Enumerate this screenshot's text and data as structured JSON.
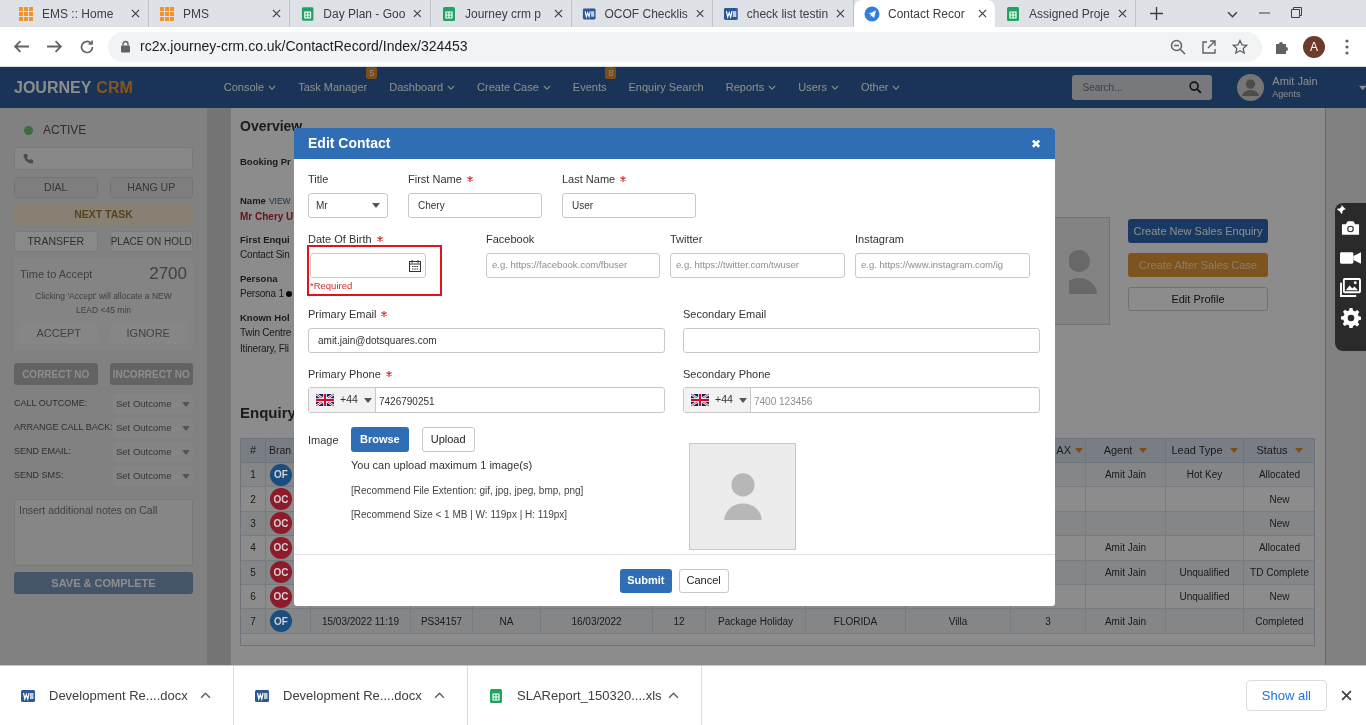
{
  "browser": {
    "tabs": [
      {
        "title": "EMS :: Home",
        "kind": "grid",
        "selected": false
      },
      {
        "title": "PMS",
        "kind": "grid",
        "selected": false
      },
      {
        "title": "Day Plan - Goo",
        "kind": "sheet",
        "selected": false
      },
      {
        "title": "Journey crm p",
        "kind": "sheet",
        "selected": false
      },
      {
        "title": "OCOF Checklis",
        "kind": "word",
        "selected": false
      },
      {
        "title": "check list testin",
        "kind": "word",
        "selected": false
      },
      {
        "title": "Contact Recor",
        "kind": "plane",
        "selected": true
      },
      {
        "title": "Assigned Proje",
        "kind": "sheet",
        "selected": false
      }
    ],
    "url": "rc2x.journey-crm.co.uk/ContactRecord/Index/324453",
    "profile_initial": "A"
  },
  "header": {
    "logo": [
      "JOURNEY",
      "CRM"
    ],
    "nav": [
      {
        "label": "Console",
        "dropdown": true
      },
      {
        "label": "Task Manager",
        "dropdown": false,
        "badge": "5"
      },
      {
        "label": "Dashboard",
        "dropdown": true
      },
      {
        "label": "Create Case",
        "dropdown": true
      },
      {
        "label": "Events",
        "dropdown": false,
        "badge": "8"
      },
      {
        "label": "Enquiry Search",
        "dropdown": false
      },
      {
        "label": "Reports",
        "dropdown": true
      },
      {
        "label": "Users",
        "dropdown": true
      },
      {
        "label": "Other",
        "dropdown": true
      }
    ],
    "search_placeholder": "Search...",
    "user": {
      "name": "Amit Jain",
      "role": "Agents"
    }
  },
  "call_panel": {
    "status": "ACTIVE",
    "dial": "DIAL",
    "hang_up": "HANG UP",
    "next_task": "NEXT TASK",
    "transfer": "TRANSFER",
    "hold": "PLACE ON HOLD",
    "accept_box": {
      "label": "Time to Accept",
      "timer": "2700",
      "message": "Clicking 'Accept' will allocate a NEW LEAD <45 min",
      "accept": "ACCEPT",
      "ignore": "IGNORE"
    },
    "correct": "CORRECT NO",
    "incorrect": "INCORRECT NO",
    "outcomes": [
      {
        "label": "CALL OUTCOME:",
        "value": "Set Outcome"
      },
      {
        "label": "ARRANGE CALL BACK:",
        "value": "Set Outcome"
      },
      {
        "label": "SEND EMAIL:",
        "value": "Set Outcome"
      },
      {
        "label": "SEND SMS:",
        "value": "Set Outcome"
      }
    ],
    "notes_placeholder": "Insert additional notes on Call",
    "save": "SAVE & COMPLETE"
  },
  "overview": {
    "heading": "Overview",
    "booking_label": "Booking Pr",
    "name_label": "Name",
    "view_link": "VIEW",
    "name": "Mr Chery U",
    "fields": [
      {
        "label": "First Enqui",
        "lines": [
          "Contact Sin"
        ]
      },
      {
        "label": "Persona",
        "lines": [
          "Persona 1"
        ]
      },
      {
        "label": "Known Hol",
        "lines": [
          "Twin Centre",
          "Itinerary, Fli"
        ]
      }
    ],
    "actions": [
      {
        "label": "Create New Sales Enquiry",
        "kind": "primary"
      },
      {
        "label": "Create After Sales Case",
        "kind": "warning"
      },
      {
        "label": "Edit Profile",
        "kind": "default"
      }
    ]
  },
  "enquiries": {
    "heading": "Enquiry",
    "columns": [
      {
        "label": "#",
        "sortable": false
      },
      {
        "label": "Bran"
      },
      null,
      null,
      null,
      null,
      null,
      null,
      null,
      null,
      {
        "label": "AX",
        "sortable": true
      },
      {
        "label": "Agent",
        "sortable": true
      },
      {
        "label": "Lead Type",
        "sortable": true
      },
      {
        "label": "Status",
        "sortable": true
      }
    ],
    "rows": [
      {
        "cells": [
          "1",
          {
            "badge": "OF",
            "color": "#1a4d80"
          },
          null,
          null,
          null,
          null,
          null,
          null,
          null,
          null,
          null,
          "Amit Jain",
          "Hot Key",
          "Allocated"
        ]
      },
      {
        "cells": [
          "2",
          {
            "badge": "OC",
            "color": "#8e1b2b"
          },
          null,
          null,
          null,
          null,
          null,
          null,
          null,
          null,
          null,
          null,
          null,
          "New"
        ]
      },
      {
        "cells": [
          "3",
          {
            "badge": "OC",
            "color": "#8e1b2b"
          },
          null,
          null,
          null,
          null,
          null,
          null,
          null,
          null,
          null,
          null,
          null,
          "New"
        ]
      },
      {
        "cells": [
          "4",
          {
            "badge": "OC",
            "color": "#8e1b2b"
          },
          null,
          null,
          null,
          null,
          null,
          null,
          null,
          null,
          null,
          "Amit Jain",
          null,
          "Allocated"
        ]
      },
      {
        "cells": [
          "5",
          {
            "badge": "OC",
            "color": "#8e1b2b"
          },
          null,
          null,
          null,
          null,
          null,
          null,
          null,
          null,
          null,
          "Amit Jain",
          "Unqualified",
          "TD Complete"
        ]
      },
      {
        "cells": [
          "6",
          {
            "badge": "OC",
            "color": "#8e1b2b"
          },
          null,
          null,
          null,
          null,
          null,
          null,
          null,
          null,
          null,
          null,
          "Unqualified",
          "New"
        ]
      },
      {
        "cells": [
          "7",
          {
            "badge": "OF",
            "color": "#1a4d80"
          },
          "15/03/2022 11:19",
          "PS34157",
          "NA",
          "16/03/2022",
          "12",
          "Package Holiday",
          "FLORIDA",
          "Villa",
          "3",
          "Amit Jain",
          null,
          "Completed"
        ]
      }
    ]
  },
  "modal": {
    "title": "Edit Contact",
    "close": "✖",
    "rows": [
      {
        "fields": [
          {
            "kind": "select",
            "label": "Title",
            "value": "Mr",
            "required": false
          },
          {
            "kind": "text",
            "label": "First Name",
            "value": "Chery",
            "required": true
          },
          {
            "kind": "text",
            "label": "Last Name",
            "value": "User",
            "required": true
          }
        ]
      },
      {
        "fields": [
          {
            "kind": "date",
            "label": "Date Of Birth",
            "required": true,
            "error": "*Required",
            "highlighted": true
          },
          {
            "kind": "text",
            "label": "Facebook",
            "placeholder": "e.g. https://facebook.com/fbuser",
            "required": false
          },
          {
            "kind": "text",
            "label": "Twitter",
            "placeholder": "e.g. https://twitter.com/twuser",
            "required": false
          },
          {
            "kind": "text",
            "label": "Instagram",
            "placeholder": "e.g. https://www.instagram.com/ig",
            "required": false
          }
        ]
      },
      {
        "fields": [
          {
            "kind": "text",
            "label": "Primary Email",
            "value": "amit.jain@dotsquares.com",
            "required": true
          },
          {
            "kind": "text",
            "label": "Secondary Email",
            "required": false
          }
        ]
      },
      {
        "fields": [
          {
            "kind": "phone",
            "label": "Primary Phone",
            "code": "+44",
            "value": "7426790251",
            "required": true
          },
          {
            "kind": "phone",
            "label": "Secondary Phone",
            "code": "+44",
            "placeholder": "7400 123456",
            "required": false
          }
        ]
      }
    ],
    "image": {
      "label": "Image",
      "browse": "Browse",
      "upload": "Upload",
      "notes": [
        "You can upload maximum 1 image(s)",
        "[Recommend File Extention: gif, jpg, jpeg, bmp, png]",
        "[Recommend Size < 1 MB | W: 119px | H: 119px]"
      ]
    },
    "submit": "Submit",
    "cancel": "Cancel"
  },
  "downloads": {
    "items": [
      {
        "name": "Development Re....docx",
        "kind": "word"
      },
      {
        "name": "Development Re....docx",
        "kind": "word"
      },
      {
        "name": "SLAReport_150320....xls",
        "kind": "sheet"
      }
    ],
    "show_all": "Show all"
  }
}
